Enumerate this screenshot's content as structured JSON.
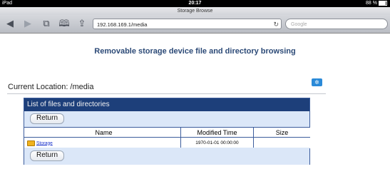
{
  "status_bar": {
    "device": "iPad",
    "time": "20:17",
    "battery": "88 %"
  },
  "browser": {
    "page_title": "Storage Browse",
    "url": "192.168.169.1/media",
    "search_placeholder": "Google",
    "icons": [
      "back-arrow-icon",
      "forward-arrow-icon",
      "tabs-icon",
      "bookmarks-icon",
      "share-icon",
      "reload-icon"
    ]
  },
  "page": {
    "heading": "Removable storage device file and directory browsing",
    "current_location": "Current Location: /media",
    "panel_title": "List of files and directories",
    "return_label": "Return",
    "columns": {
      "name": "Name",
      "modified": "Modified Time",
      "size": "Size"
    },
    "rows": [
      {
        "name": "Storage",
        "modified": "1970-01-01 00:00:00",
        "size": ""
      }
    ]
  },
  "colors": {
    "panel_header": "#1d3f7a",
    "heading": "#2c4a77",
    "settings_button": "#2b8ad8"
  }
}
